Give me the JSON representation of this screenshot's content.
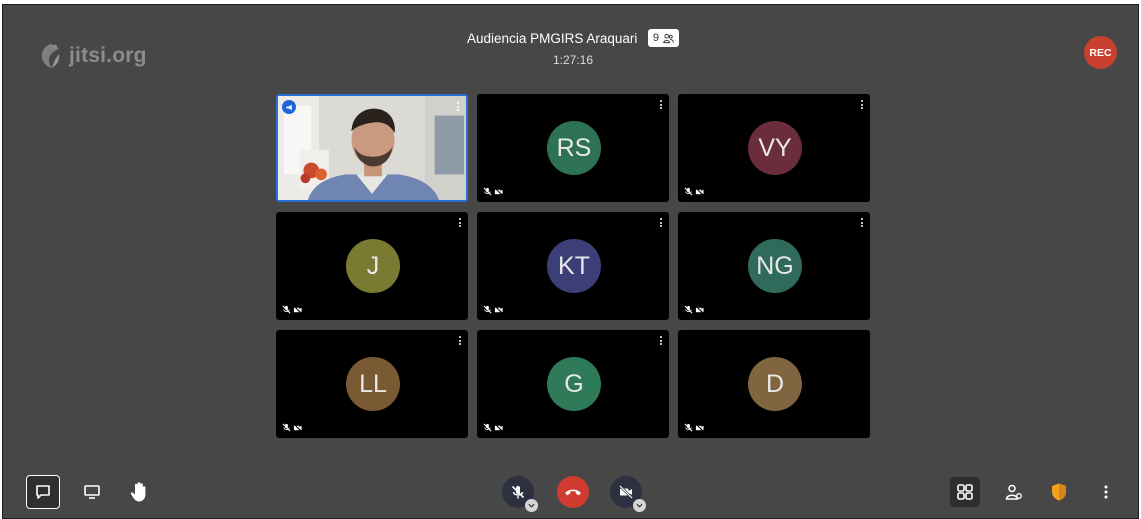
{
  "header": {
    "logo_text": "jitsi.org",
    "meeting_title": "Audiencia PMGIRS Araquari",
    "participant_count": "9",
    "timer": "1:27:16",
    "rec_label": "REC",
    "rec_color": "#c9402f"
  },
  "participants": [
    {
      "initials": "",
      "video": true,
      "color": "#000000",
      "dominant_speaker": true
    },
    {
      "initials": "RS",
      "color": "#2e7255"
    },
    {
      "initials": "VY",
      "color": "#6b2c3e"
    },
    {
      "initials": "J",
      "color": "#7a7a32"
    },
    {
      "initials": "KT",
      "color": "#3c3e78"
    },
    {
      "initials": "NG",
      "color": "#2f6a5a"
    },
    {
      "initials": "LL",
      "color": "#7a5a33"
    },
    {
      "initials": "G",
      "color": "#2f7a58"
    },
    {
      "initials": "D",
      "color": "#806540"
    }
  ],
  "toolbar": {
    "left": [
      "chat-icon",
      "screen-share-icon",
      "raise-hand-icon"
    ],
    "center": [
      "microphone-muted-icon",
      "hangup-icon",
      "camera-off-icon"
    ],
    "right": [
      "tile-view-icon",
      "invite-icon",
      "security-shield-icon",
      "more-options-icon"
    ],
    "hangup_color": "#d13c30",
    "security_color": "#f0a01c"
  }
}
